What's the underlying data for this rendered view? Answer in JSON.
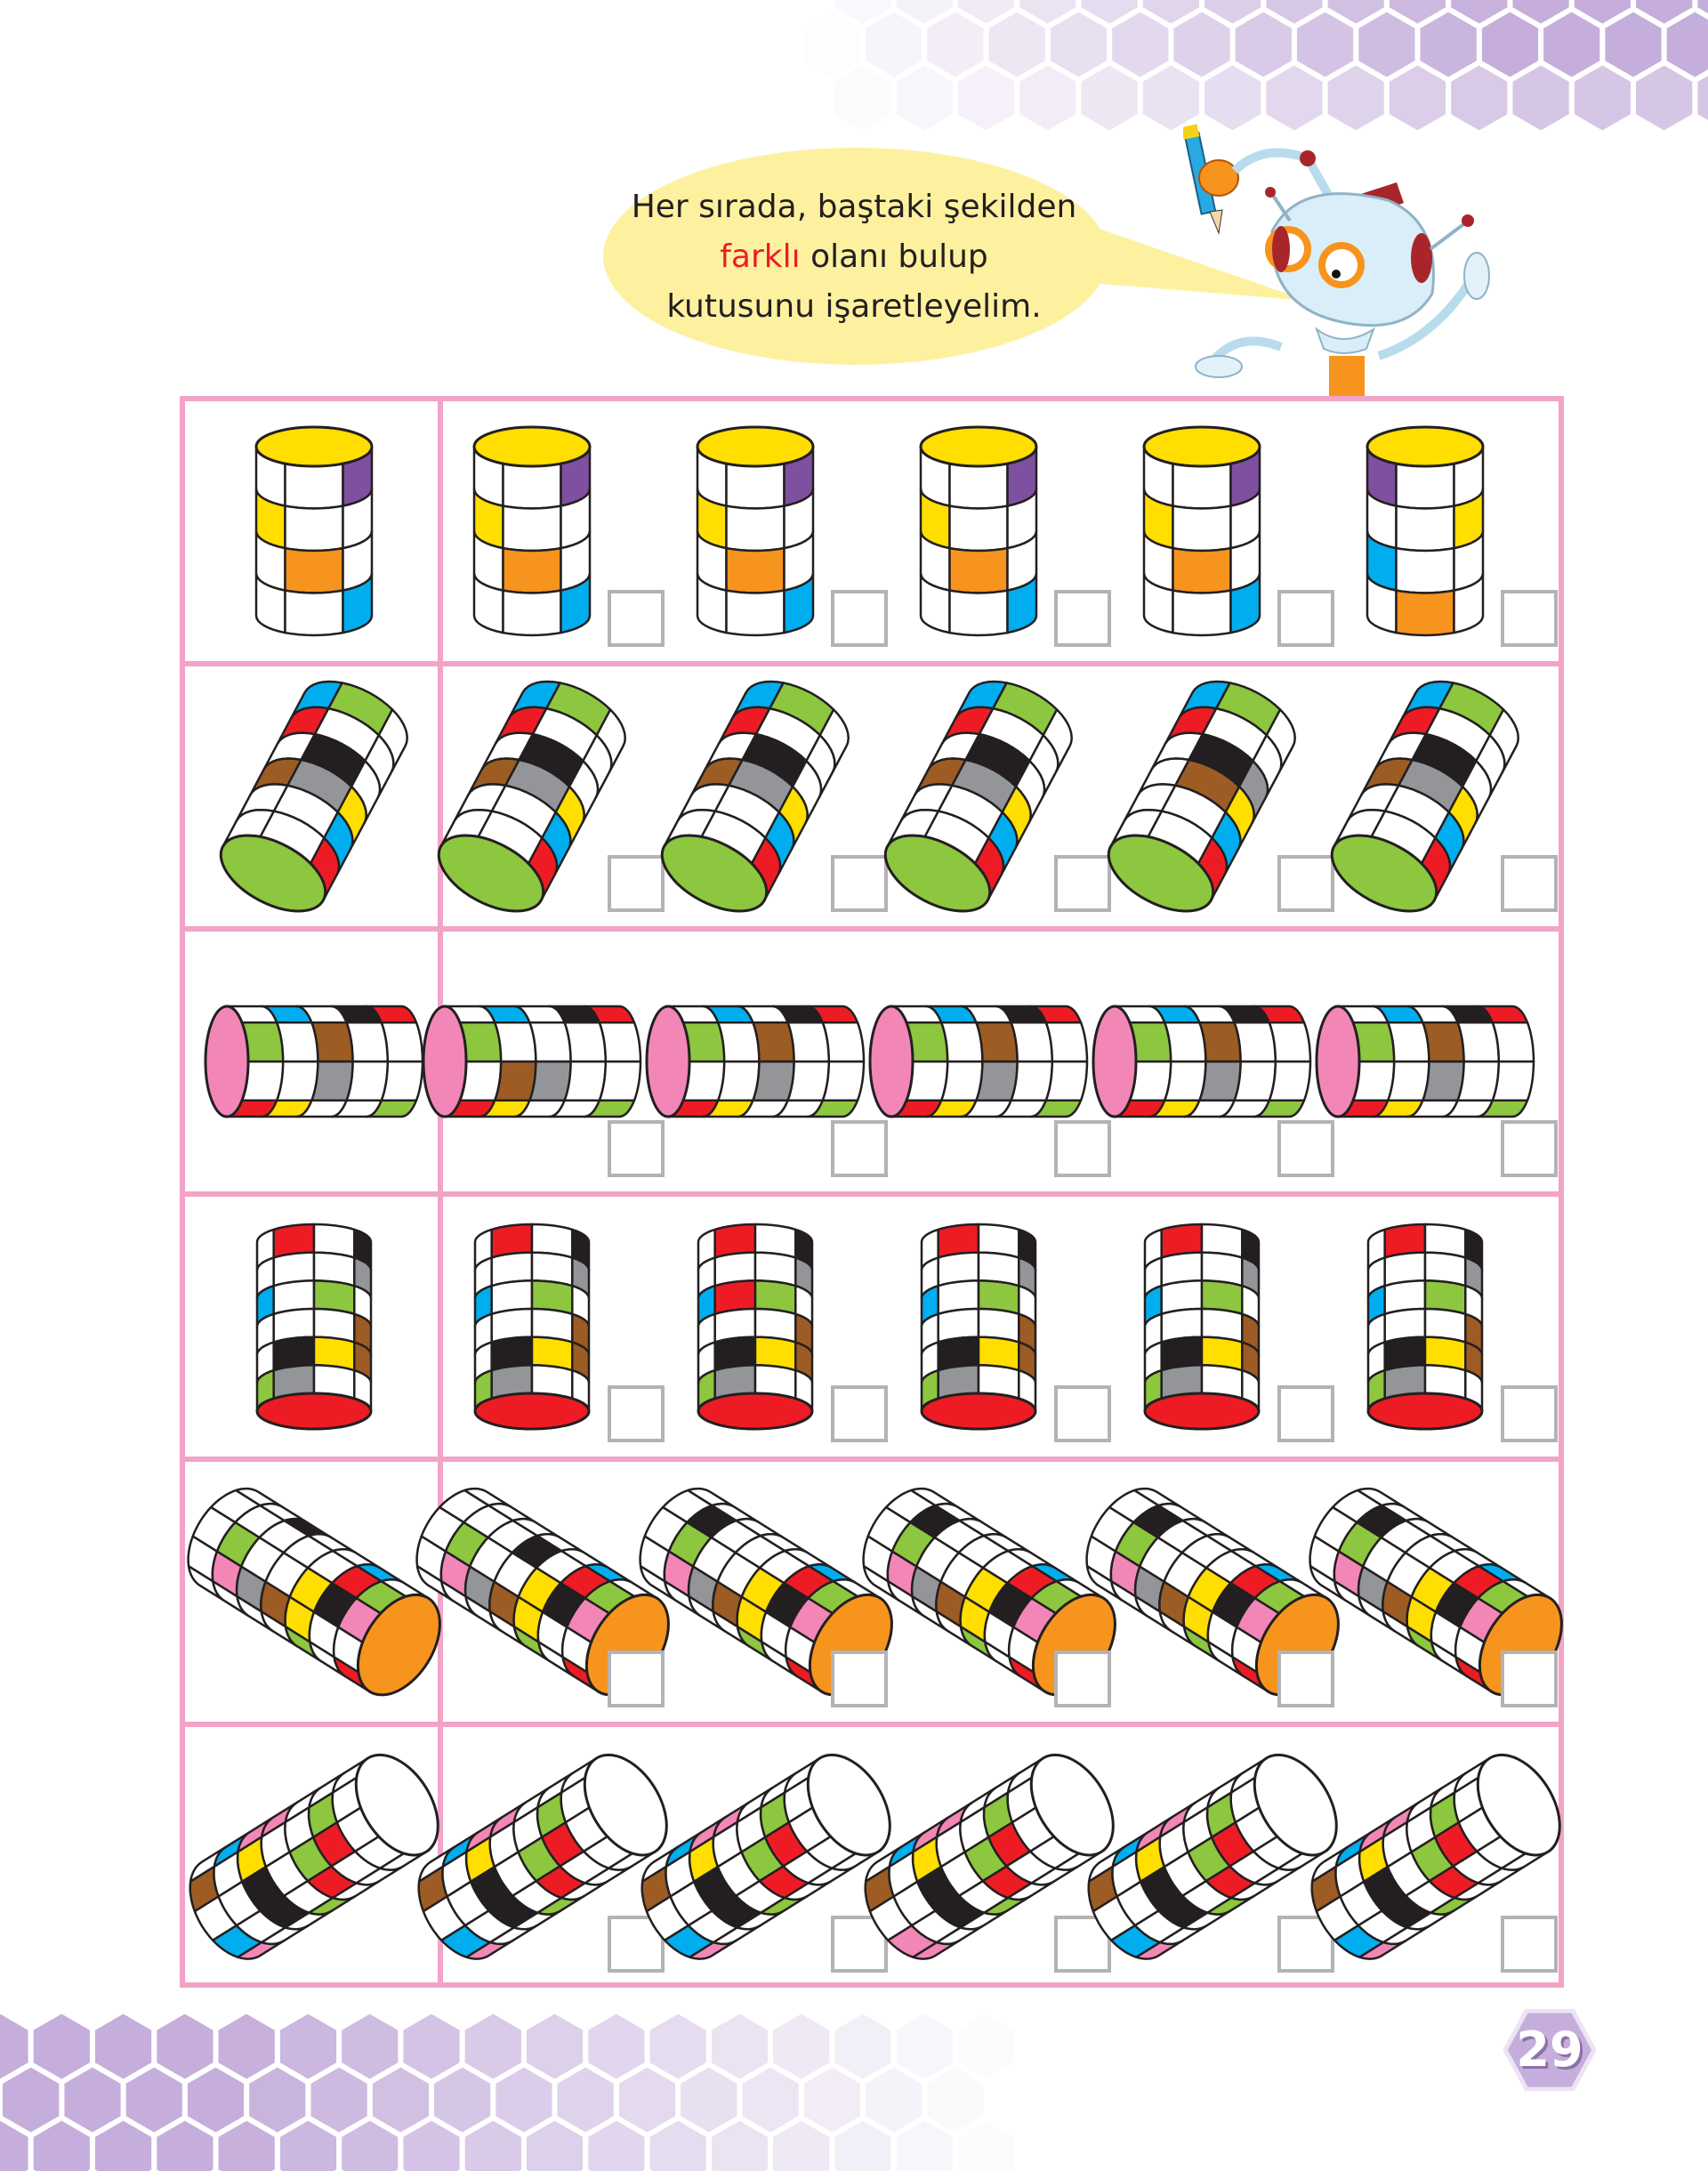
{
  "instruction": {
    "line1": "Her sırada, baştaki şekilden",
    "highlight": "farklı",
    "line2_rest": " olanı bulup",
    "line3": "kutusunu işaretleyelim."
  },
  "page_number": "29",
  "colors": {
    "table_border": "#f3a3c7",
    "bubble": "#fdf1a0",
    "highlight": "#ed1c24",
    "hexagon": "#c5aedb",
    "checkbox_border": "#b3b3b5"
  },
  "palette": {
    "W": "#ffffff",
    "Y": "#ffde00",
    "P": "#7f4fa0",
    "O": "#f7941d",
    "B": "#00aeef",
    "G": "#8dc63f",
    "R": "#ed1c24",
    "K": "#231f20",
    "A": "#939598",
    "N": "#9c5c24",
    "I": "#f287b7"
  },
  "rows": [
    {
      "cap_color": "#ffde00",
      "reference": [
        "WWP",
        "YWW",
        "WOW",
        "WWB"
      ],
      "options": [
        {
          "grid": [
            "WWP",
            "YWW",
            "WOW",
            "WWB"
          ],
          "checked": false
        },
        {
          "grid": [
            "WWP",
            "YWW",
            "WOW",
            "WWB"
          ],
          "checked": false
        },
        {
          "grid": [
            "WWP",
            "YWW",
            "WOW",
            "WWB"
          ],
          "checked": false
        },
        {
          "grid": [
            "WWP",
            "YWW",
            "WOW",
            "WWB"
          ],
          "checked": false
        },
        {
          "grid": [
            "PWW",
            "WWY",
            "BWW",
            "WOW"
          ],
          "checked": false
        }
      ]
    },
    {
      "cap_color": "#8dc63f",
      "reference": [
        "BGW",
        "RWW",
        "WKW",
        "NAY",
        "WWB",
        "WWR"
      ],
      "options": [
        {
          "grid": [
            "BGW",
            "RWW",
            "WKW",
            "NAY",
            "WWB",
            "WWR"
          ],
          "checked": false
        },
        {
          "grid": [
            "BGW",
            "RWW",
            "WKW",
            "NAY",
            "WWB",
            "WWR"
          ],
          "checked": false
        },
        {
          "grid": [
            "BGW",
            "RWW",
            "WKW",
            "NAY",
            "WWB",
            "WWR"
          ],
          "checked": false
        },
        {
          "grid": [
            "BGW",
            "RWW",
            "WKA",
            "WNY",
            "WWB",
            "WWR"
          ],
          "checked": false
        },
        {
          "grid": [
            "BGW",
            "RWW",
            "WKW",
            "NAY",
            "WWB",
            "WWR"
          ],
          "checked": false
        }
      ]
    },
    {
      "cap_color": "#f287b7",
      "reference": [
        "RWGW",
        "YWWB",
        "WANW",
        "WWWK",
        "GWWR"
      ],
      "options": [
        {
          "grid": [
            "RWGW",
            "YNWB",
            "WAWW",
            "WWWK",
            "GWWR"
          ],
          "checked": false
        },
        {
          "grid": [
            "RWGW",
            "YWWB",
            "WANW",
            "WWWK",
            "GWWR"
          ],
          "checked": false
        },
        {
          "grid": [
            "RWGW",
            "YWWB",
            "WANW",
            "WWWK",
            "GWWR"
          ],
          "checked": false
        },
        {
          "grid": [
            "RWGW",
            "YWWB",
            "WANW",
            "WWWK",
            "GWWR"
          ],
          "checked": false
        },
        {
          "grid": [
            "RWGW",
            "YWWB",
            "WANW",
            "WWWK",
            "GWWR"
          ],
          "checked": false
        }
      ]
    },
    {
      "cap_color": "#ed1c24",
      "reference": [
        "WRWK",
        "WWWA",
        "BWGW",
        "WWWN",
        "WKYN",
        "GAWW"
      ],
      "options": [
        {
          "grid": [
            "WRWK",
            "WWWA",
            "BWGW",
            "WWWN",
            "WKYN",
            "GAWW"
          ],
          "checked": false
        },
        {
          "grid": [
            "WRWK",
            "WWWA",
            "BRGW",
            "WWWN",
            "WKYN",
            "GAWW"
          ],
          "checked": false
        },
        {
          "grid": [
            "WRWK",
            "WWWA",
            "BWGW",
            "WWWN",
            "WKYN",
            "GAWW"
          ],
          "checked": false
        },
        {
          "grid": [
            "WRWK",
            "WWWA",
            "BWGW",
            "WWWN",
            "WKYN",
            "GAWW"
          ],
          "checked": false
        },
        {
          "grid": [
            "WRWK",
            "WWWA",
            "BWGW",
            "WWWN",
            "WKYN",
            "GAWW"
          ],
          "checked": false
        }
      ]
    },
    {
      "cap_color": "#f7941d",
      "reference": [
        "WWWWW",
        "WIGWW",
        "WAWWK",
        "WNWWW",
        "GYYWW",
        "WWKRB",
        "RWIGW"
      ],
      "options": [
        {
          "grid": [
            "WWWWW",
            "WIGWW",
            "WAWWW",
            "WNWKW",
            "GYYWW",
            "WWKRB",
            "RWIGW"
          ],
          "checked": false
        },
        {
          "grid": [
            "WWWWW",
            "WIGKW",
            "WAWWW",
            "WNWWW",
            "GYYWW",
            "WWKRB",
            "RWIGW"
          ],
          "checked": false
        },
        {
          "grid": [
            "WWWWW",
            "WIGKW",
            "WAWWW",
            "WNWWW",
            "GYYWW",
            "WWKRB",
            "RWIGW"
          ],
          "checked": false
        },
        {
          "grid": [
            "WWWWW",
            "WIGKW",
            "WAWWW",
            "WNWWW",
            "GYYWW",
            "WWKRB",
            "RWIGW"
          ],
          "checked": false
        },
        {
          "grid": [
            "WWWWW",
            "WIGKW",
            "WAWWW",
            "WNWWW",
            "GYYWW",
            "WWKRB",
            "RWIGW"
          ],
          "checked": false
        }
      ]
    },
    {
      "cap_color": "#ffffff",
      "reference": [
        "WWWWW",
        "WGRWW",
        "WWGRW",
        "IWWWG",
        "IYKKW",
        "BWWWW",
        "WNWBI"
      ],
      "options": [
        {
          "grid": [
            "WWWWW",
            "WGRWW",
            "WWGRW",
            "IWWWG",
            "IYKKW",
            "BWWWW",
            "WNWBI"
          ],
          "checked": false
        },
        {
          "grid": [
            "WWWWW",
            "WGRWW",
            "WWGRW",
            "IWWWG",
            "IYKKW",
            "BWWWW",
            "WNWBI"
          ],
          "checked": false
        },
        {
          "grid": [
            "WWWWW",
            "WGRWW",
            "WWGRW",
            "IWWWG",
            "IYKKW",
            "BWWWW",
            "WNWII"
          ],
          "checked": false
        },
        {
          "grid": [
            "WWWWW",
            "WGRWW",
            "WWGRW",
            "IWWWG",
            "IYKKW",
            "BWWWW",
            "WNWBI"
          ],
          "checked": false
        },
        {
          "grid": [
            "WWWWW",
            "WGRWW",
            "WWGRW",
            "IWWWG",
            "IYKKW",
            "BWWWW",
            "WNWBI"
          ],
          "checked": false
        }
      ]
    }
  ]
}
